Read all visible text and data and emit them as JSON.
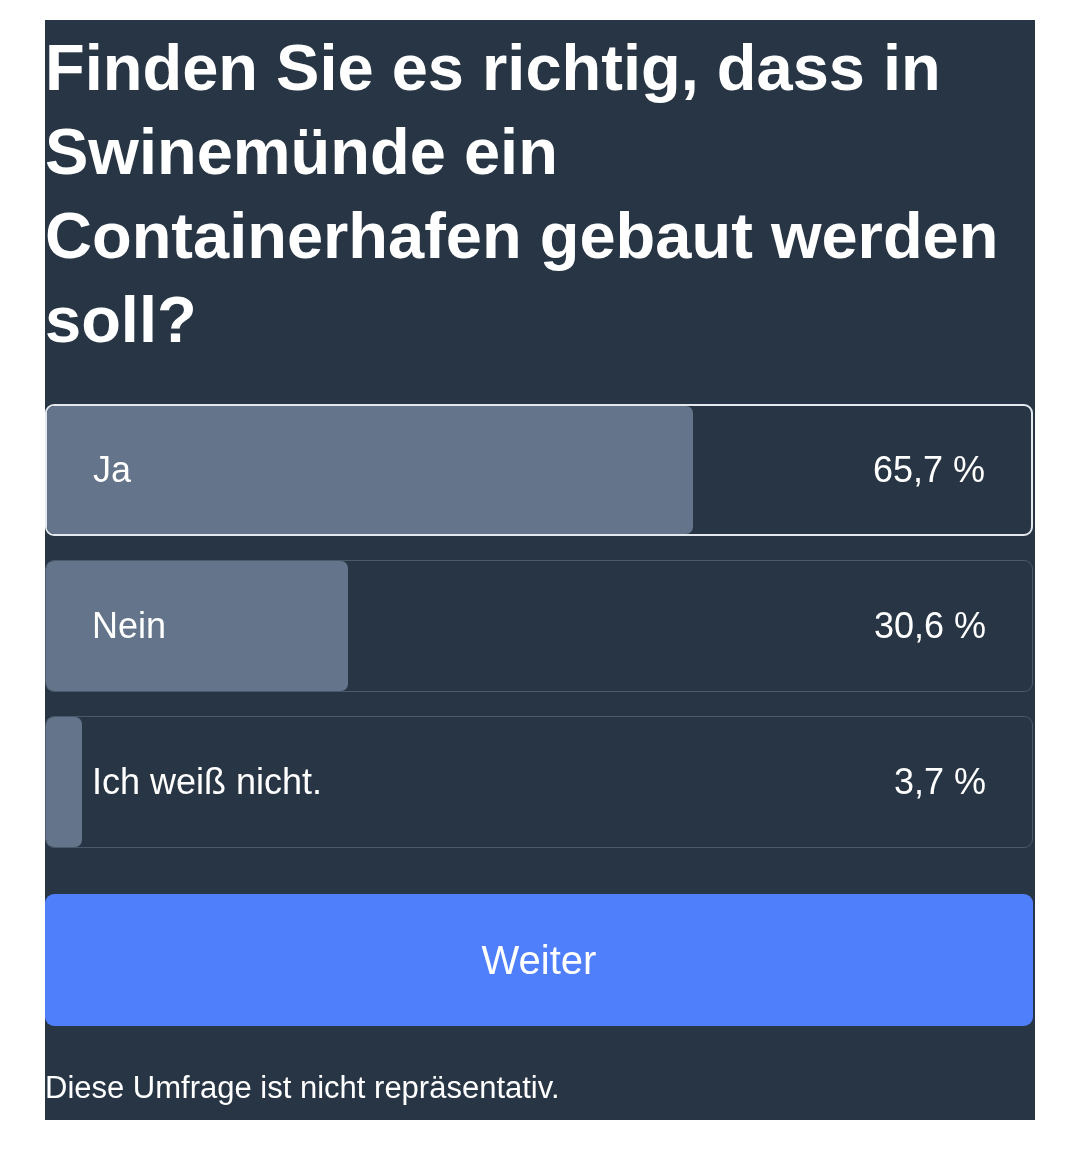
{
  "question": "Finden Sie es richtig, dass in Swinemünde ein Containerhafen gebaut werden soll?",
  "options": [
    {
      "label": "Ja",
      "percent": "65,7 %",
      "level": 0.657,
      "selected": true
    },
    {
      "label": "Nein",
      "percent": "30,6 %",
      "level": 0.306,
      "selected": false
    },
    {
      "label": "Ich weiß nicht.",
      "percent": "3,7 %",
      "level": 0.037,
      "selected": false
    }
  ],
  "button": {
    "label": "Weiter"
  },
  "footer": "Diese Umfrage ist nicht repräsentativ."
}
